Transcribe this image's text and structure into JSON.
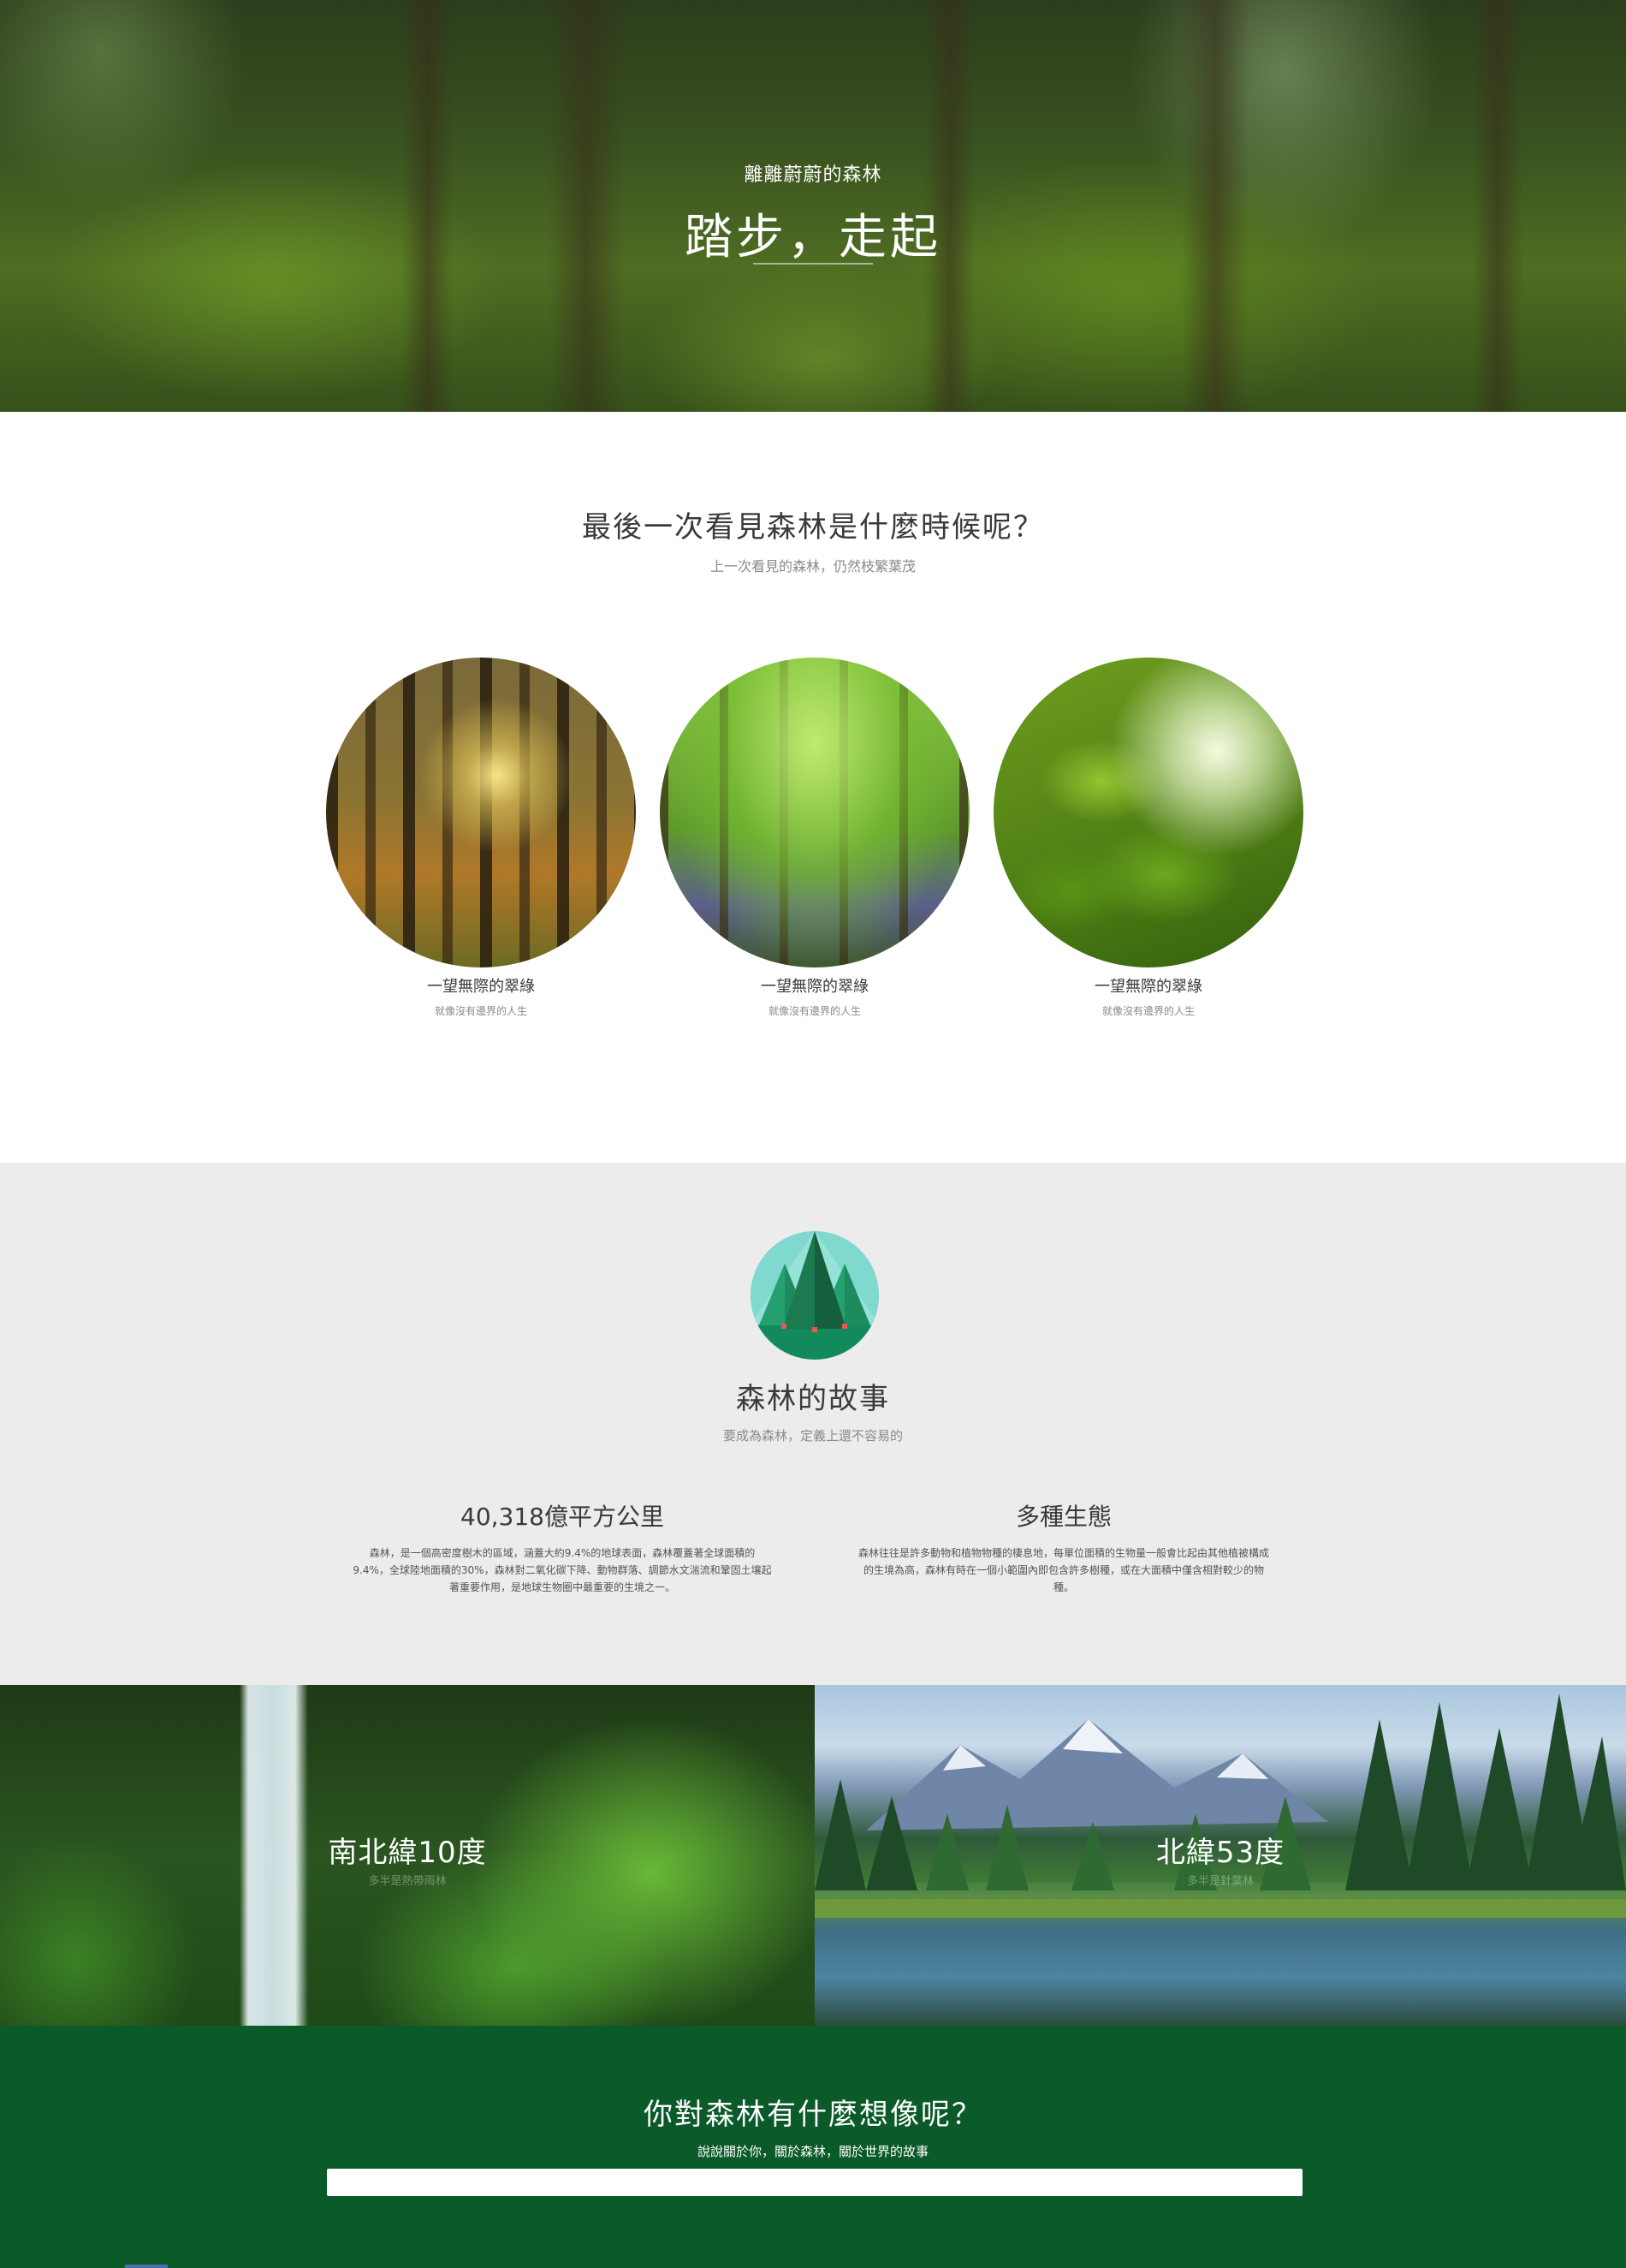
{
  "hero": {
    "subtitle": "離離蔚蔚的森林",
    "title": "踏步，走起"
  },
  "intro": {
    "title": "最後一次看見森林是什麼時候呢？",
    "subtitle": "上一次看見的森林，仍然枝繁葉茂",
    "cards": [
      {
        "title": "一望無際的翠綠",
        "subtitle": "就像沒有邊界的人生"
      },
      {
        "title": "一望無際的翠綠",
        "subtitle": "就像沒有邊界的人生"
      },
      {
        "title": "一望無際的翠綠",
        "subtitle": "就像沒有邊界的人生"
      }
    ]
  },
  "story": {
    "icon": "forest-trees-icon",
    "title": "森林的故事",
    "subtitle": "要成為森林，定義上還不容易的",
    "facts": [
      {
        "heading": "40,318億平方公里",
        "body": "森林，是一個高密度樹木的區域，涵蓋大約9.4%的地球表面，森林覆蓋著全球面積的9.4%，全球陸地面積的30%，森林對二氧化碳下降、動物群落、調節水文湍流和鞏固土壤起著重要作用，是地球生物圈中最重要的生境之一。"
      },
      {
        "heading": "多種生態",
        "body": "森林往往是許多動物和植物物種的棲息地，每單位面積的生物量一般會比起由其他植被構成的生境為高，森林有時在一個小範圍內即包含許多樹種，或在大面積中僅含相對較少的物種。"
      }
    ]
  },
  "regions": [
    {
      "title": "南北緯10度",
      "subtitle": "多半是熱帶雨林"
    },
    {
      "title": "北緯53度",
      "subtitle": "多半是針葉林"
    }
  ],
  "contact": {
    "title": "你對森林有什麼想像呢？",
    "subtitle": "說說關於你，關於森林，關於世界的故事",
    "input_value": ""
  },
  "colors": {
    "footer_green": "#0b5a2a",
    "grey_section": "#ececec",
    "badge_teal": "#7fd9cf"
  }
}
